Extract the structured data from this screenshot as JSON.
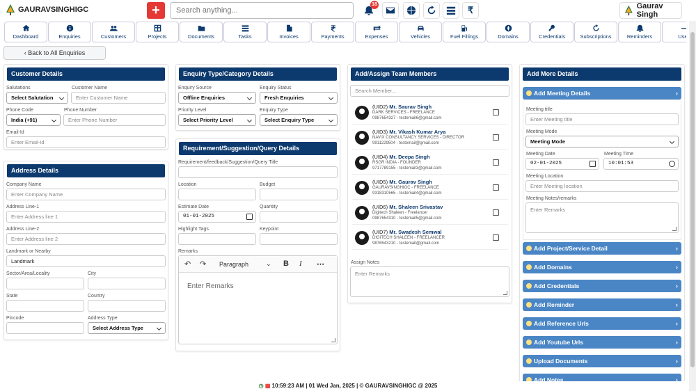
{
  "brand": {
    "name": "GAURAVSINGHIGC"
  },
  "search": {
    "placeholder": "Search anything..."
  },
  "notifications": {
    "count": "18"
  },
  "user": {
    "name": "Gaurav Singh"
  },
  "nav": [
    {
      "label": "Dashboard",
      "icon": "home-icon"
    },
    {
      "label": "Enquiries",
      "icon": "info-icon"
    },
    {
      "label": "Customers",
      "icon": "users-icon"
    },
    {
      "label": "Projects",
      "icon": "grid-icon"
    },
    {
      "label": "Documents",
      "icon": "folder-icon"
    },
    {
      "label": "Tasks",
      "icon": "tasks-icon"
    },
    {
      "label": "Invoices",
      "icon": "pdf-icon"
    },
    {
      "label": "Payments",
      "icon": "rupee-icon"
    },
    {
      "label": "Expenses",
      "icon": "exchange-icon"
    },
    {
      "label": "Vehicles",
      "icon": "car-icon"
    },
    {
      "label": "Fuel Fillings",
      "icon": "fuel-icon"
    },
    {
      "label": "Domains",
      "icon": "globe-icon"
    },
    {
      "label": "Credentials",
      "icon": "key-icon"
    },
    {
      "label": "Subscriptions",
      "icon": "refresh-icon"
    },
    {
      "label": "Reminders",
      "icon": "bell-icon"
    },
    {
      "label": "Usef",
      "icon": "link-icon"
    }
  ],
  "back_label": "‹ Back to All Enquiries",
  "customer": {
    "title": "Customer Details",
    "salutations_label": "Salutations",
    "salutation_value": "Select Salutation",
    "customer_name_label": "Customer Name",
    "customer_name_placeholder": "Enter Customer Name",
    "phone_code_label": "Phone Code",
    "phone_code_value": "India (+91)",
    "phone_number_label": "Phone Number",
    "phone_number_placeholder": "Enter Phone Number",
    "email_label": "Email-Id",
    "email_placeholder": "Enter Email-Id"
  },
  "address": {
    "title": "Address Details",
    "company_label": "Company Name",
    "company_placeholder": "Enter Company Name",
    "line1_label": "Address Line-1",
    "line1_placeholder": "Enter Address line 1",
    "line2_label": "Address Line-2",
    "line2_placeholder": "Enter Address line 2",
    "landmark_label": "Landmark or Nearby",
    "landmark_value": "Landmark",
    "sector_label": "Sector/Area/Locality",
    "city_label": "City",
    "state_label": "State",
    "country_label": "Country",
    "pincode_label": "Pincode",
    "address_type_label": "Address Type",
    "address_type_value": "Select Address Type"
  },
  "enquiry": {
    "title": "Enquiry Type/Category Details",
    "source_label": "Enquiry Source",
    "source_value": "Offline Enquiries",
    "status_label": "Enquiry Status",
    "status_value": "Fresh Enquiries",
    "priority_label": "Priority Level",
    "priority_value": "Select Priority Level",
    "type_label": "Enquiry Type",
    "type_value": "Select Enquiry Type"
  },
  "requirement": {
    "title": "Requirement/Suggestion/Query Details",
    "title_label": "Requirement/feedback/Suggestion/Query Title",
    "location_label": "Location",
    "budget_label": "Budget",
    "estimate_label": "Estimate Date",
    "estimate_value": "01-01-2025",
    "quantity_label": "Quantity",
    "tags_label": "Highlight Tags",
    "keypoint_label": "Keypoint",
    "remarks_label": "Remarks",
    "paragraph_label": "Paragraph",
    "remarks_placeholder": "Enter Remarks"
  },
  "team": {
    "title": "Add/Assign Team Members",
    "search_placeholder": "Search Member...",
    "assign_notes_label": "Assign Notes",
    "assign_notes_placeholder": "Enter Remarks",
    "members": [
      {
        "uid": "(UID2)",
        "name": "Mr. Saurav Singh",
        "company": "DARK SERVICES - FREELANCE",
        "contact": "0987654327 - testemail6@gmail.com"
      },
      {
        "uid": "(UID3)",
        "name": "Mr. Vikash Kumar Arya",
        "company": "NAVIX CONSULTANCY SERVICES - DIRECTOR",
        "contact": "9911229504 - testemail@gmail.com"
      },
      {
        "uid": "(UID4)",
        "name": "Mr. Deepa Singh",
        "company": "RSGR INDIA - FOUNDER",
        "contact": "9717789155 - testemail3@gmail.com"
      },
      {
        "uid": "(UID5)",
        "name": "Mr. Gaurav Singh",
        "company": "GAURAVSINGHIGC - FREELANCE",
        "contact": "9318310565 - testemail4@gmail.com"
      },
      {
        "uid": "(UID6)",
        "name": "Mr. Shaleen Srivastav",
        "company": "Digitech Shaleen - Freelancer",
        "contact": "0987654310 - testemail5@gmail.com"
      },
      {
        "uid": "(UID7)",
        "name": "Mr. Swadesh Semwal",
        "company": "DIGITECH SHALEEN - FREELANCER",
        "contact": "9876543210 - testemail@gmail.com"
      }
    ]
  },
  "more": {
    "title": "Add More Details",
    "meeting_header": "Add Meeting Details",
    "meeting_title_label": "Meeting title",
    "meeting_title_placeholder": "Enter Meeting title",
    "meeting_mode_label": "Meeting Mode",
    "meeting_mode_value": "Meeting Mode",
    "meeting_date_label": "Meeting Date",
    "meeting_date_value": "02-01-2025",
    "meeting_time_label": "Meeting Time",
    "meeting_time_value": "10:01:53",
    "meeting_location_label": "Meeting Location",
    "meeting_location_placeholder": "Enter Meeting location",
    "meeting_notes_label": "Meeting Notes/remarks",
    "meeting_notes_placeholder": "Enter Remarks",
    "sections": [
      "Add Project/Service Detail",
      "Add Domains",
      "Add Credentials",
      "Add Reminder",
      "Add Reference Urls",
      "Add Youtube Urls",
      "Upload Documents",
      "Add Notes"
    ]
  },
  "footer": {
    "text": "10:59:23 AM | 01 Wed Jan, 2025 | © GAURAVSINGHIGC @ 2025"
  },
  "colors": {
    "primary": "#0d3a6e",
    "accordion": "#4a86c5",
    "danger": "#e53935"
  }
}
